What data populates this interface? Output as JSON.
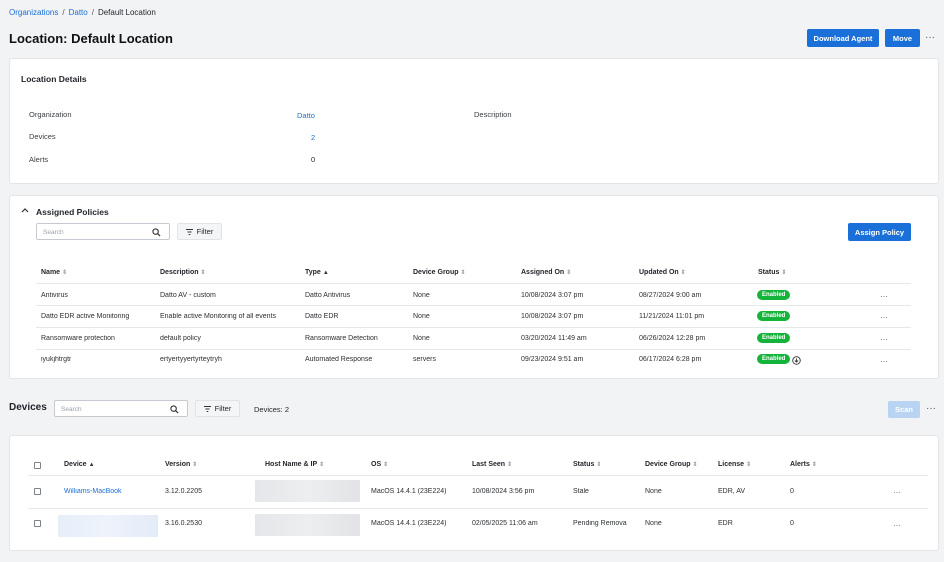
{
  "breadcrumb": [
    "Organizations",
    "Datto",
    "Default Location"
  ],
  "page_title": "Location:  Default Location",
  "header_actions": {
    "download_agent": "Download Agent",
    "move": "Move",
    "more": "···"
  },
  "location_details": {
    "title": "Location Details",
    "organization_label": "Organization",
    "organization_value": "Datto",
    "devices_label": "Devices",
    "devices_value": "2",
    "alerts_label": "Alerts",
    "alerts_value": "0",
    "description_label": "Description"
  },
  "policies": {
    "title": "Assigned Policies",
    "search_placeholder": "Search",
    "filter_label": "Filter",
    "assign_label": "Assign Policy",
    "columns": [
      "Name",
      "Description",
      "Type",
      "Device Group",
      "Assigned On",
      "Updated On",
      "Status"
    ],
    "rows": [
      {
        "name": "Antivirus",
        "description": "Datto AV - custom",
        "type": "Datto Antivirus",
        "group": "None",
        "assigned": "10/08/2024 3:07 pm",
        "updated": "08/27/2024 9:00 am",
        "status": "Enabled"
      },
      {
        "name": "Datto EDR active Monitoring",
        "description": "Enable active Monitoring of all events",
        "type": "Datto EDR",
        "group": "None",
        "assigned": "10/08/2024 3:07 pm",
        "updated": "11/21/2024 11:01 pm",
        "status": "Enabled"
      },
      {
        "name": "Ransomware protection",
        "description": "default policy",
        "type": "Ransomware Detection",
        "group": "None",
        "assigned": "03/20/2024 11:49 am",
        "updated": "06/26/2024 12:28 pm",
        "status": "Enabled"
      },
      {
        "name": "iyukjhtrgtr",
        "description": "ertyertyyertyrteytryh",
        "type": "Automated Response",
        "group": "servers",
        "assigned": "09/23/2024 9:51 am",
        "updated": "06/17/2024 6:28 pm",
        "status": "Enabled"
      }
    ]
  },
  "devices": {
    "title": "Devices",
    "search_placeholder": "Search",
    "filter_label": "Filter",
    "count_label": "Devices: 2",
    "scan_label": "Scan",
    "columns": [
      "Device",
      "Version",
      "Host Name & IP",
      "OS",
      "Last Seen",
      "Status",
      "Device Group",
      "License",
      "Alerts"
    ],
    "rows": [
      {
        "device": "Williams-MacBook",
        "version": "3.12.0.2205",
        "os": "MacOS 14.4.1 (23E224)",
        "last_seen": "10/08/2024 3:56 pm",
        "status": "Stale",
        "group": "None",
        "license": "EDR, AV",
        "alerts": "0"
      },
      {
        "device": "",
        "version": "3.16.0.2530",
        "os": "MacOS 14.4.1 (23E224)",
        "last_seen": "02/05/2025 11:06 am",
        "status": "Pending Remova",
        "group": "None",
        "license": "EDR",
        "alerts": "0"
      }
    ]
  },
  "colors": {
    "accent": "#1a6fd8",
    "enabled": "#16b33b",
    "scan_disabled": "#b9d3f3"
  }
}
